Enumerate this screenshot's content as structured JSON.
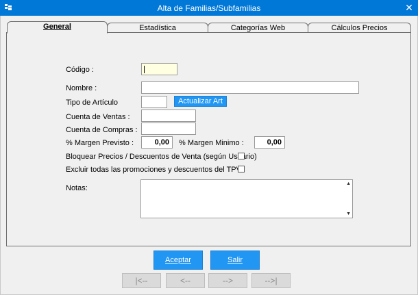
{
  "window": {
    "title": "Alta de Familias/Subfamilias",
    "close_glyph": "✕"
  },
  "tabs": [
    {
      "label": "General",
      "active": true
    },
    {
      "label": "Estadística",
      "active": false
    },
    {
      "label": "Categorías Web",
      "active": false
    },
    {
      "label": "Cálculos Precios",
      "active": false
    }
  ],
  "form": {
    "codigo_label": "Código :",
    "codigo_value": "",
    "nombre_label": "Nombre :",
    "nombre_value": "",
    "tipo_label": "Tipo de Artículo",
    "tipo_value": "",
    "actualizar_label": "Actualizar Art",
    "cuenta_ventas_label": "Cuenta de Ventas :",
    "cuenta_ventas_value": "",
    "cuenta_compras_label": "Cuenta de Compras :",
    "cuenta_compras_value": "",
    "margen_previsto_label": "% Margen Previsto :",
    "margen_previsto_value": "0,00",
    "margen_minimo_label": "% Margen Minimo :",
    "margen_minimo_value": "0,00",
    "bloquear_label": "Bloquear Precios / Descuentos de Venta (según Usuario)",
    "bloquear_checked": false,
    "excluir_label": "Excluir todas las promociones y descuentos del TPV",
    "excluir_checked": false,
    "notas_label": "Notas:",
    "notas_value": ""
  },
  "buttons": {
    "aceptar": "Aceptar",
    "salir": "Salir",
    "first": "|<--",
    "prev": "<--",
    "next": "-->",
    "last": "-->|"
  },
  "colors": {
    "titlebar": "#0078d7",
    "accent_button": "#2196f3",
    "field_highlight": "#ffffe1"
  }
}
